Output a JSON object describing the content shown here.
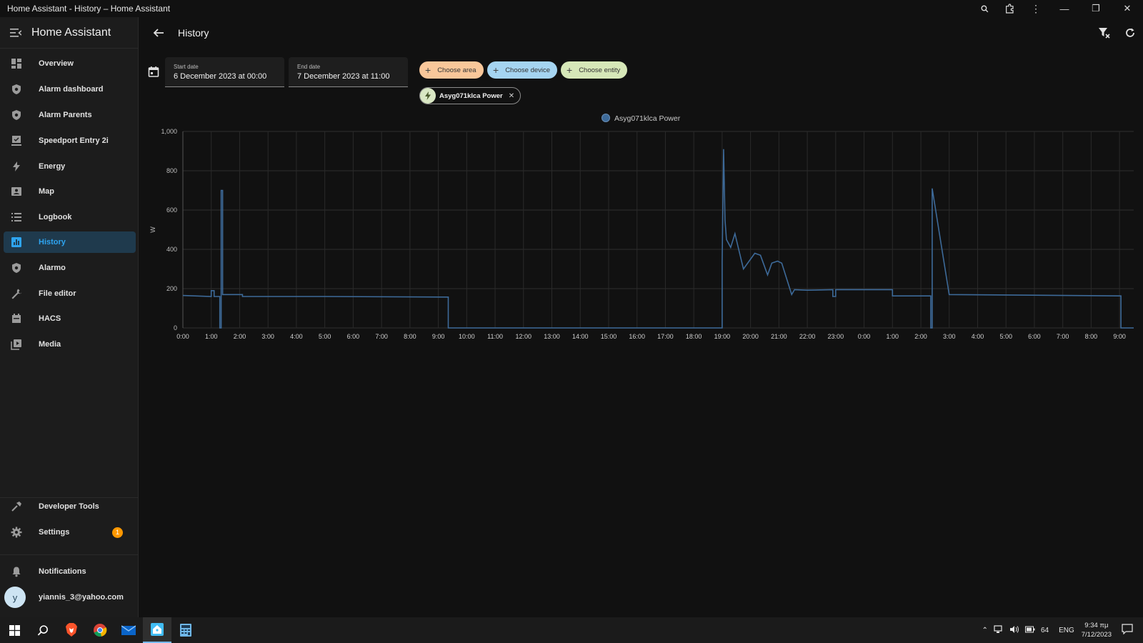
{
  "window": {
    "title": "Home Assistant - History – Home Assistant"
  },
  "sidebar": {
    "title": "Home Assistant",
    "items": [
      {
        "label": "Overview",
        "icon": "dashboard-icon"
      },
      {
        "label": "Alarm dashboard",
        "icon": "shield-icon"
      },
      {
        "label": "Alarm Parents",
        "icon": "shield-icon"
      },
      {
        "label": "Speedport Entry 2i",
        "icon": "router-icon"
      },
      {
        "label": "Energy",
        "icon": "lightning-icon"
      },
      {
        "label": "Map",
        "icon": "map-icon"
      },
      {
        "label": "Logbook",
        "icon": "list-icon"
      },
      {
        "label": "History",
        "icon": "chart-box-icon",
        "active": true
      },
      {
        "label": "Alarmo",
        "icon": "shield-icon"
      },
      {
        "label": "File editor",
        "icon": "wrench-icon"
      },
      {
        "label": "HACS",
        "icon": "hacs-icon"
      },
      {
        "label": "Media",
        "icon": "media-icon"
      }
    ],
    "developer_tools": "Developer Tools",
    "settings": "Settings",
    "settings_badge": "1",
    "notifications": "Notifications",
    "user": {
      "initial": "y",
      "name": "yiannis_3@yahoo.com"
    }
  },
  "header": {
    "title": "History"
  },
  "filters": {
    "start_label": "Start date",
    "start_value": "6 December 2023 at 00:00",
    "end_label": "End date",
    "end_value": "7 December 2023 at 11:00",
    "choose_area": "Choose area",
    "choose_device": "Choose device",
    "choose_entity": "Choose entity",
    "entity_chip": "Asyg071klca Power"
  },
  "colors": {
    "accent": "#2ea4f0",
    "series": "#3d6a99",
    "area_chip": "#f9c79a",
    "device_chip": "#a5d4f1",
    "entity_chip": "#d6e7b8",
    "badge": "#ff9800"
  },
  "chart_data": {
    "type": "line",
    "title": "",
    "xlabel": "",
    "ylabel": "W",
    "ylim": [
      0,
      1000
    ],
    "yticks": [
      "0",
      "200",
      "400",
      "600",
      "800",
      "1,000"
    ],
    "xticks": [
      "0:00",
      "1:00",
      "2:00",
      "3:00",
      "4:00",
      "5:00",
      "6:00",
      "7:00",
      "8:00",
      "9:00",
      "10:00",
      "11:00",
      "12:00",
      "13:00",
      "14:00",
      "15:00",
      "16:00",
      "17:00",
      "18:00",
      "19:00",
      "20:00",
      "21:00",
      "22:00",
      "23:00",
      "0:00",
      "1:00",
      "2:00",
      "3:00",
      "4:00",
      "5:00",
      "6:00",
      "7:00",
      "8:00",
      "9:00"
    ],
    "legend": "top-center",
    "grid": true,
    "series": [
      {
        "name": "Asyg071klca Power",
        "x": [
          0,
          1.0,
          1.0,
          1.1,
          1.1,
          1.3,
          1.3,
          1.35,
          1.35,
          1.4,
          1.4,
          2.1,
          2.1,
          4,
          5,
          9.35,
          9.35,
          10,
          19.0,
          19.0,
          19.05,
          19.05,
          19.1,
          19.1,
          19.15,
          19.15,
          19.3,
          19.3,
          19.45,
          19.45,
          19.55,
          19.55,
          19.75,
          19.75,
          20.15,
          20.15,
          20.35,
          20.35,
          20.6,
          20.6,
          20.75,
          20.75,
          20.95,
          20.95,
          21.1,
          21.1,
          21.45,
          21.45,
          21.55,
          21.55,
          22,
          22.9,
          22.9,
          23.0,
          23.0,
          25.0,
          25.0,
          26.35,
          26.35,
          26.4,
          26.4,
          27,
          33.05,
          33.05,
          33.5
        ],
        "y": [
          165,
          160,
          190,
          190,
          160,
          160,
          0,
          0,
          700,
          700,
          170,
          170,
          160,
          160,
          160,
          157,
          0,
          0,
          0,
          340,
          910,
          910,
          550,
          550,
          450,
          450,
          410,
          410,
          480,
          480,
          420,
          420,
          300,
          300,
          380,
          380,
          370,
          370,
          270,
          270,
          330,
          330,
          340,
          340,
          330,
          330,
          170,
          170,
          195,
          195,
          192,
          195,
          160,
          160,
          195,
          195,
          163,
          163,
          0,
          0,
          710,
          170,
          163,
          0,
          0
        ]
      }
    ]
  },
  "taskbar": {
    "language": "ENG",
    "battery": "64",
    "time": "9:34 πμ",
    "date": "7/12/2023"
  }
}
